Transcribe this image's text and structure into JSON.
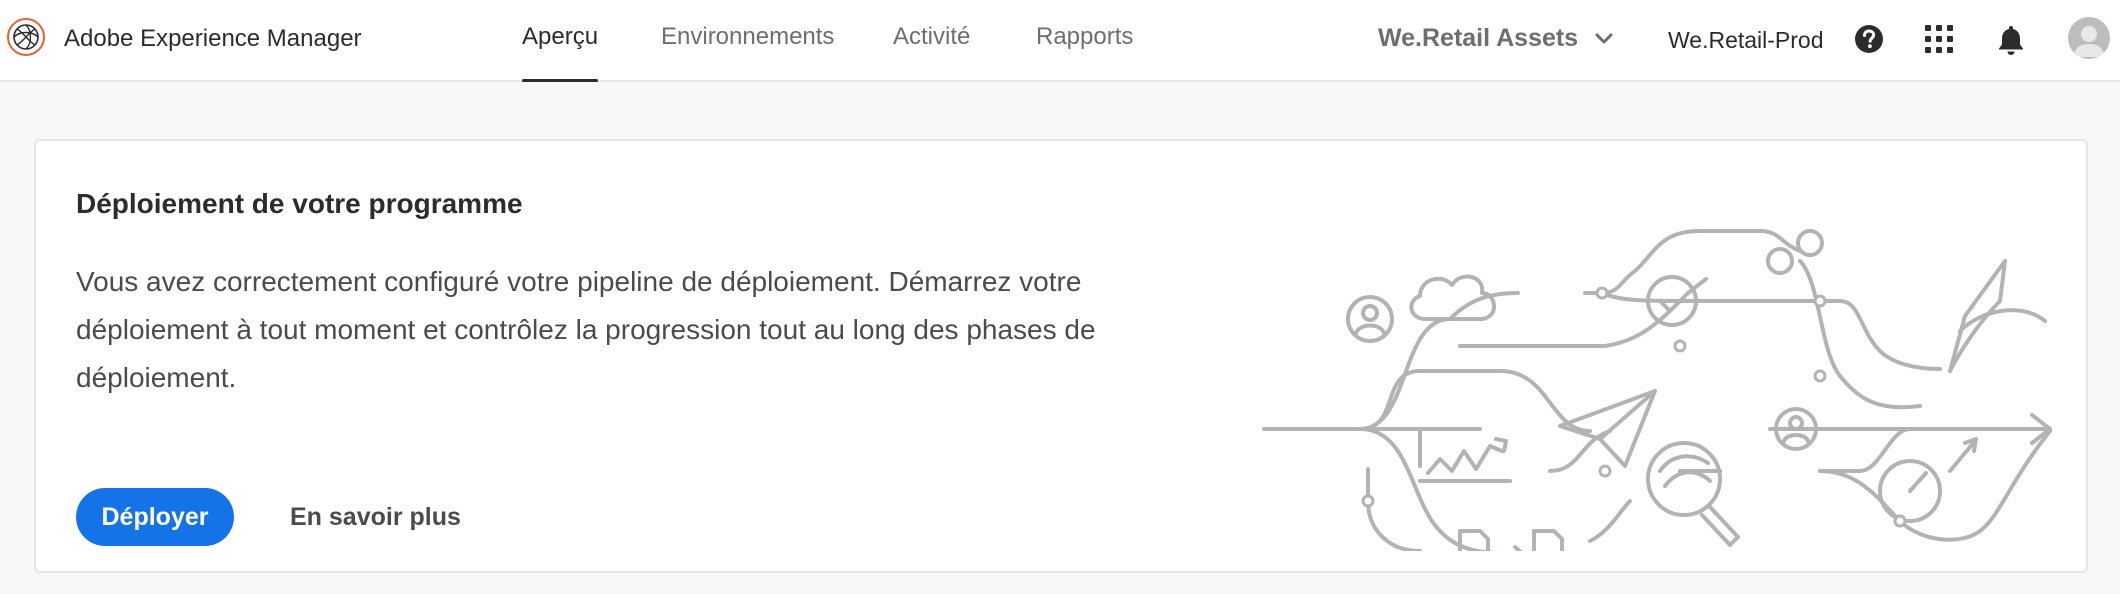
{
  "header": {
    "app_title": "Adobe Experience Manager",
    "logo_icon": "adobe-experience-manager-logo",
    "tabs": [
      {
        "label": "Aperçu",
        "active": true
      },
      {
        "label": "Environnements",
        "active": false
      },
      {
        "label": "Activité",
        "active": false
      },
      {
        "label": "Rapports",
        "active": false
      }
    ],
    "program_selector": {
      "value": "We.Retail Assets",
      "icon": "chevron-down-icon"
    },
    "environment": "We.Retail-Prod",
    "icons": [
      "help-icon",
      "apps-grid-icon",
      "notifications-bell-icon",
      "user-avatar"
    ]
  },
  "card": {
    "title": "Déploiement de votre programme",
    "description": "Vous avez correctement configuré votre pipeline de déploiement. Démarrez votre déploiement à tout moment et contrôlez la progression tout au long des phases de déploiement.",
    "primary_button": "Déployer",
    "secondary_link": "En savoir plus",
    "illustration": "deployment-pipeline-illustration"
  },
  "colors": {
    "accent": "#1473e6",
    "logo_ring": "#e8612c",
    "illustration_stroke": "#b3b3b3",
    "background": "#f8f8f8"
  }
}
